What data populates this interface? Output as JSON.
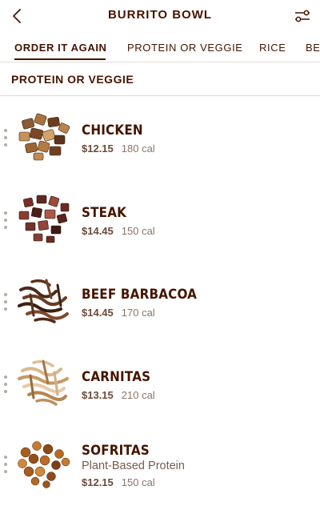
{
  "header": {
    "title": "BURRITO BOWL"
  },
  "tabs": [
    {
      "label": "ORDER IT AGAIN",
      "active": true
    },
    {
      "label": "PROTEIN OR VEGGIE",
      "active": false
    },
    {
      "label": "RICE",
      "active": false
    },
    {
      "label": "BE",
      "active": false
    }
  ],
  "section": {
    "title": "PROTEIN OR VEGGIE"
  },
  "items": [
    {
      "name": "CHICKEN",
      "price": "$12.15",
      "calories": "180 cal"
    },
    {
      "name": "STEAK",
      "price": "$14.45",
      "calories": "150 cal"
    },
    {
      "name": "BEEF BARBACOA",
      "price": "$14.45",
      "calories": "170 cal"
    },
    {
      "name": "CARNITAS",
      "price": "$13.15",
      "calories": "210 cal"
    },
    {
      "name": "SOFRITAS",
      "subtitle": "Plant-Based Protein",
      "price": "$12.15",
      "calories": "150 cal"
    }
  ],
  "colors": {
    "brand_brown": "#451400",
    "divider": "#e3dcd8",
    "drag_dots": "#b7aaa2"
  }
}
